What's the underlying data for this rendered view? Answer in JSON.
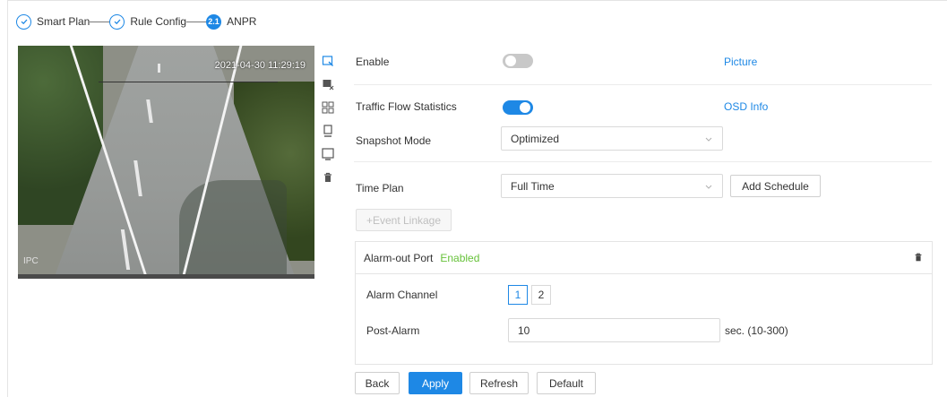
{
  "steps": [
    {
      "label": "Smart Plan",
      "state": "done"
    },
    {
      "label": "Rule Config",
      "state": "done"
    },
    {
      "label": "ANPR",
      "state": "active",
      "badge": "2.1"
    }
  ],
  "video": {
    "timestamp": "2021-04-30 11:29:19",
    "channel_label": "IPC"
  },
  "tools": [
    "draw-rule-icon",
    "clear-rule-icon",
    "grid-icon",
    "min-target-icon",
    "max-target-icon",
    "delete-icon"
  ],
  "form": {
    "enable_label": "Enable",
    "enable_on": false,
    "picture_link": "Picture",
    "traffic_label": "Traffic Flow Statistics",
    "traffic_on": true,
    "osd_link": "OSD Info",
    "snapshot_label": "Snapshot Mode",
    "snapshot_value": "Optimized",
    "timeplan_label": "Time Plan",
    "timeplan_value": "Full Time",
    "add_schedule": "Add Schedule",
    "event_linkage": "+Event Linkage"
  },
  "alarm": {
    "title": "Alarm-out Port",
    "status": "Enabled",
    "channel_label": "Alarm Channel",
    "channels": [
      "1",
      "2"
    ],
    "selected_channel": "1",
    "post_label": "Post-Alarm",
    "post_value": "10",
    "post_unit": "sec. (10-300)"
  },
  "footer": {
    "back": "Back",
    "apply": "Apply",
    "refresh": "Refresh",
    "default": "Default"
  },
  "colors": {
    "accent": "#1e88e5",
    "enabled": "#67c23a"
  }
}
